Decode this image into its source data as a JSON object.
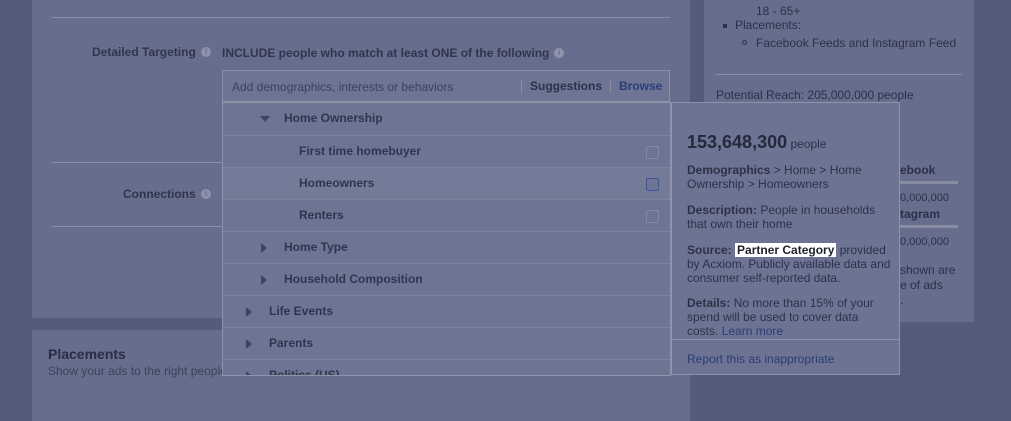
{
  "summary": {
    "age_range": "18 - 65+",
    "placements_label": "Placements:",
    "placements_value": "Facebook Feeds and Instagram Feed",
    "potential_reach": "Potential Reach: 205,000,000 people",
    "frag_1": "ebook",
    "frag_2": "0,000,000",
    "frag_3": "tagram",
    "frag_4": "0,000,000",
    "frag_5": "shown are",
    "frag_6": "e of ads",
    "frag_7": "."
  },
  "targeting": {
    "label": "Detailed Targeting",
    "include_text": "INCLUDE people who match at least ONE of the following",
    "search_placeholder": "Add demographics, interests or behaviors",
    "suggestions_label": "Suggestions",
    "browse_label": "Browse",
    "connections_label": "Connections"
  },
  "placements": {
    "title": "Placements",
    "subtitle": "Show your ads to the right people"
  },
  "tree": [
    {
      "label": "Home Ownership"
    },
    {
      "label": "First time homebuyer"
    },
    {
      "label": "Homeowners"
    },
    {
      "label": "Renters"
    },
    {
      "label": "Home Type"
    },
    {
      "label": "Household Composition"
    },
    {
      "label": "Life Events"
    },
    {
      "label": "Parents"
    },
    {
      "label": "Politics (US)"
    }
  ],
  "tooltip": {
    "count": "153,648,300",
    "count_unit": "people",
    "demographics_label": "Demographics",
    "demographics_path": " > Home > Home Ownership > Homeowners",
    "description_label": "Description:",
    "description_text": " People in households that own their home",
    "source_label": "Source:",
    "source_highlight": "Partner Category",
    "source_text": " provided by Acxiom. Publicly available data and consumer self-reported data.",
    "details_label": "Details:",
    "details_text": " No more than 15% of your spend will be used to cover data costs. ",
    "learn_more": "Learn more",
    "report_link": "Report this as inappropriate"
  }
}
